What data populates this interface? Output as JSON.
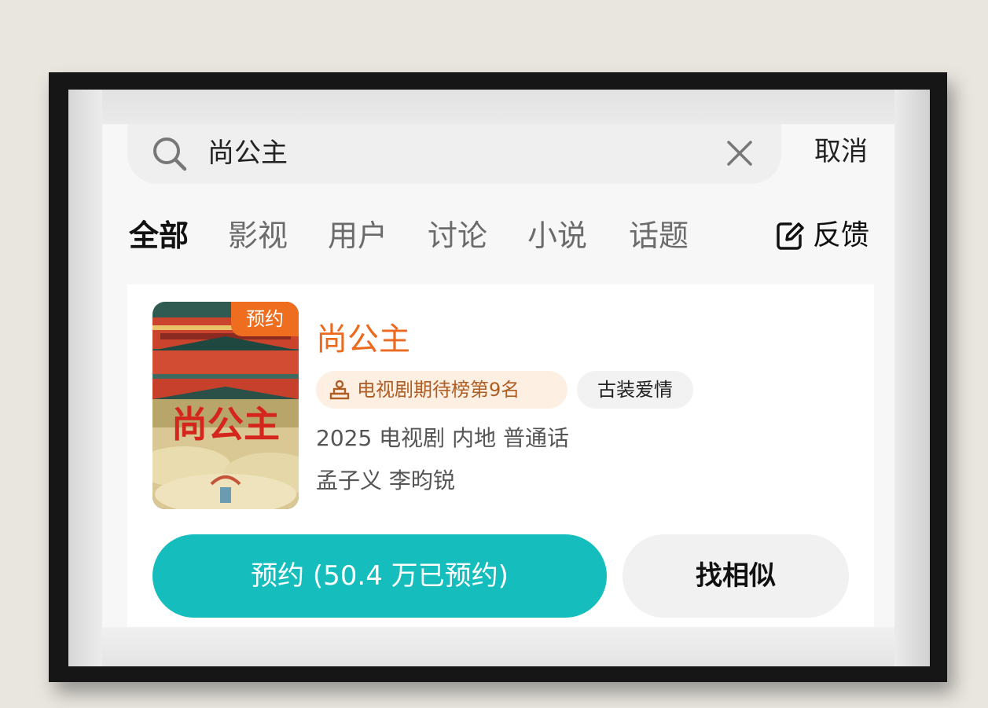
{
  "search": {
    "query": "尚公主",
    "cancel_label": "取消",
    "icon": "search-icon",
    "clear_icon": "close-icon"
  },
  "tabs": [
    {
      "label": "全部",
      "active": true
    },
    {
      "label": "影视",
      "active": false
    },
    {
      "label": "用户",
      "active": false
    },
    {
      "label": "讨论",
      "active": false
    },
    {
      "label": "小说",
      "active": false
    },
    {
      "label": "话题",
      "active": false
    }
  ],
  "feedback": {
    "label": "反馈",
    "icon": "edit-icon"
  },
  "result": {
    "poster_badge": "预约",
    "title": "尚公主",
    "rank_tag": "电视剧期待榜第9名",
    "rank_icon": "trophy-icon",
    "genre_tag": "古装爱情",
    "meta": "2025 电视剧 内地 普通话",
    "cast": "孟子义 李昀锐",
    "reserve_label": "预约 (50.4 万已预约)",
    "similar_label": "找相似"
  },
  "colors": {
    "accent_orange": "#ec6a1f",
    "button_teal": "#15bdbd",
    "rank_tag_bg": "#fdf0e3",
    "frame": "#161616"
  }
}
